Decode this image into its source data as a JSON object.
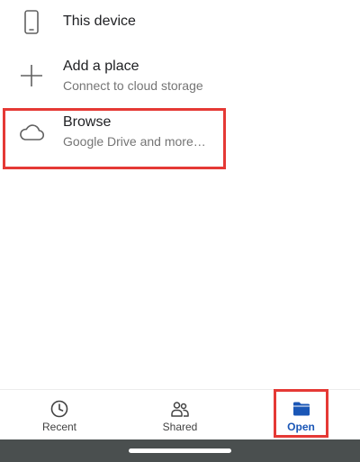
{
  "locations": [
    {
      "title": "This device",
      "icon": "phone-icon"
    },
    {
      "title": "Add a place",
      "subtitle": "Connect to cloud storage",
      "icon": "plus-icon"
    },
    {
      "title": "Browse",
      "subtitle": "Google Drive and more…",
      "icon": "cloud-icon"
    }
  ],
  "bottom_nav": {
    "items": [
      {
        "label": "Recent",
        "icon": "clock-icon"
      },
      {
        "label": "Shared",
        "icon": "people-icon"
      },
      {
        "label": "Open",
        "icon": "folder-icon",
        "selected": true
      }
    ]
  },
  "colors": {
    "accent": "#1a56b6",
    "highlight": "#e53935",
    "system_bar": "#4a4f4f"
  }
}
